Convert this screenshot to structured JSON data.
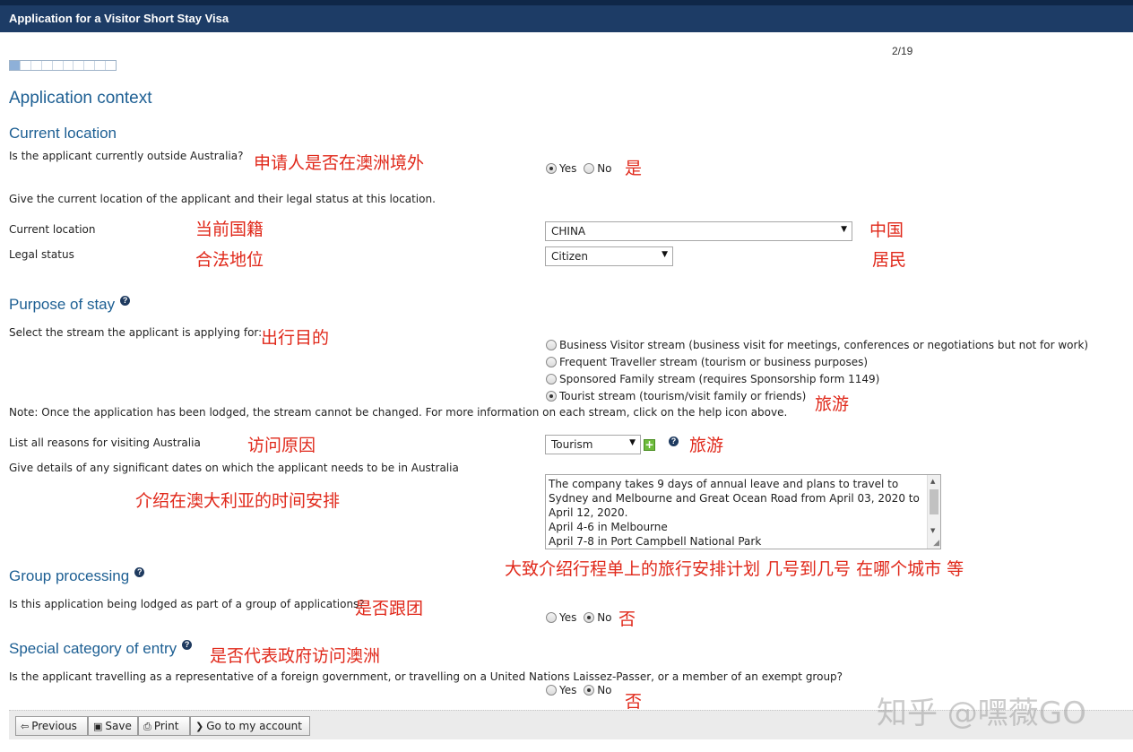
{
  "window": {
    "title": "Application for a Visitor Short Stay Visa"
  },
  "page_indicator": "2/19",
  "progress": {
    "current_step": 1,
    "total_segments": 10,
    "fraction": 0.1
  },
  "page_title": "Application context",
  "current_location": {
    "heading": "Current location",
    "outside_question": "Is the applicant currently outside Australia?",
    "outside_annotation": "申请人是否在澳洲境外",
    "outside_options": [
      "Yes",
      "No"
    ],
    "outside_selected": "Yes",
    "outside_answer_annotation": "是",
    "instruction": "Give the current location of the applicant and their legal status at this location.",
    "location_label": "Current location",
    "location_annotation": "当前国籍",
    "location_value": "CHINA",
    "location_value_annotation": "中国",
    "status_label": "Legal status",
    "status_annotation": "合法地位",
    "status_value": "Citizen",
    "status_value_annotation": "居民"
  },
  "purpose": {
    "heading": "Purpose of stay",
    "stream_question": "Select the stream the applicant is applying for:",
    "stream_annotation": "出行目的",
    "streams": [
      {
        "label": "Business Visitor stream (business visit for meetings, conferences or negotiations but not for work)",
        "selected": false
      },
      {
        "label": "Frequent Traveller stream (tourism or business purposes)",
        "selected": false
      },
      {
        "label": "Sponsored Family stream (requires Sponsorship form 1149)",
        "selected": false
      },
      {
        "label": "Tourist stream (tourism/visit family or friends)",
        "selected": true
      }
    ],
    "stream_selected_annotation": "旅游",
    "note": "Note: Once the application has been lodged, the stream cannot be changed. For more information on each stream, click on the help icon above.",
    "reasons_label": "List all reasons for visiting Australia",
    "reasons_annotation": "访问原因",
    "reasons_value": "Tourism",
    "reasons_value_annotation": "旅游",
    "dates_label": "Give details of any significant dates on which the applicant needs to be in Australia",
    "dates_annotation": "介绍在澳大利亚的时间安排",
    "dates_text": "The company takes 9 days of annual leave and plans to travel to Sydney and Melbourne and Great Ocean Road from April 03, 2020 to April 12, 2020.\nApril 4-6 in Melbourne\nApril 7-8 in Port Campbell National Park",
    "dates_text_annotation": "大致介绍行程单上的旅行安排计划 几号到几号 在哪个城市 等"
  },
  "group": {
    "heading": "Group processing",
    "question": "Is this application being lodged as part of a group of applications?",
    "annotation": "是否跟团",
    "options": [
      "Yes",
      "No"
    ],
    "selected": "No",
    "answer_annotation": "否"
  },
  "special": {
    "heading": "Special category of entry",
    "heading_annotation": "是否代表政府访问澳洲",
    "question": "Is the applicant travelling as a representative of a foreign government, or travelling on a United Nations Laissez-Passer, or a member of an exempt group?",
    "options": [
      "Yes",
      "No"
    ],
    "selected": "No",
    "answer_annotation": "否"
  },
  "footer": {
    "previous": "Previous",
    "save": "Save",
    "print": "Print",
    "account": "Go to my account"
  },
  "watermark": "知乎 @嘿薇GO",
  "colors": {
    "title_bar": "#1d3c66",
    "heading": "#1d5f93",
    "annotation": "#e0281a",
    "footer_bar": "#ebebeb"
  },
  "icons": {
    "help": "question-circle-icon",
    "add": "plus-square-icon",
    "previous": "arrow-left-icon",
    "save": "floppy-disk-icon",
    "print": "printer-icon",
    "account": "chevron-right-icon"
  }
}
